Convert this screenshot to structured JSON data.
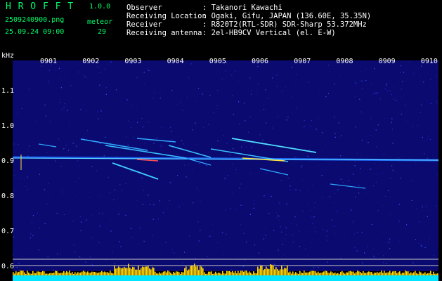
{
  "app": {
    "title": "H R O F F T",
    "version": "1.0.0"
  },
  "file": {
    "name": "2509240900.png",
    "datetime": "25.09.24 09:00"
  },
  "meteor": {
    "label": "meteor",
    "count": "29"
  },
  "info": [
    {
      "label": "Observer",
      "value": ": Takanori Kawachi"
    },
    {
      "label": "Receiving Location",
      "value": ": Ogaki, Gifu, JAPAN (136.60E, 35.35N)"
    },
    {
      "label": "Receiver",
      "value": ": R820T2(RTL-SDR) SDR-Sharp 53.372MHz"
    },
    {
      "label": "Receiving antenna",
      "value": ": 2el-HB9CV Vertical (el. E-W)"
    }
  ],
  "axis": {
    "y_unit": "kHz",
    "x_ticks": [
      "0901",
      "0902",
      "0903",
      "0904",
      "0905",
      "0906",
      "0907",
      "0908",
      "0909",
      "0910"
    ],
    "y_ticks": [
      "1.1",
      "1.0",
      "0.9",
      "0.8",
      "0.7",
      "0.6"
    ]
  },
  "colors": {
    "header_text": "#00ff6a",
    "info_text": "#ffffff",
    "background": "#000000",
    "spectrum": "#0a0a70",
    "signal": "#00bfff",
    "level_bar": "#ffd400",
    "baseline": "#00e5ff"
  }
}
